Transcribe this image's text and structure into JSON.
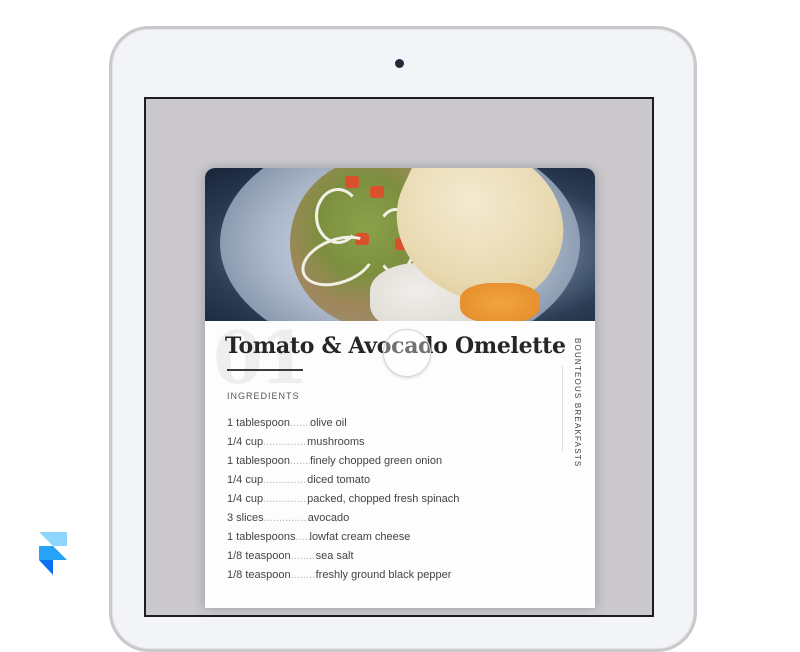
{
  "recipe": {
    "number": "01",
    "title": "Tomato & Avocado Omelette",
    "category": "BOUNTEOUS BREAKFASTS",
    "section_label": "INGREDIENTS",
    "ingredients": [
      {
        "qty": "1 tablespoon",
        "item": "olive oil"
      },
      {
        "qty": "1/4 cup",
        "item": "mushrooms"
      },
      {
        "qty": "1 tablespoon",
        "item": "finely chopped green onion"
      },
      {
        "qty": "1/4 cup",
        "item": "diced tomato"
      },
      {
        "qty": "1/4 cup",
        "item": "packed, chopped fresh spinach"
      },
      {
        "qty": "3 slices",
        "item": "avocado"
      },
      {
        "qty": "1 tablespoons",
        "item": "lowfat cream cheese"
      },
      {
        "qty": "1/8 teaspoon",
        "item": "sea salt"
      },
      {
        "qty": "1/8 teaspoon",
        "item": "freshly ground black pepper"
      }
    ],
    "leader": "................................"
  },
  "colors": {
    "screen_bg": "#cbc9cd",
    "device_bezel": "#f3f4f8",
    "logo_light": "#8fd6ff",
    "logo_mid": "#27a3f5",
    "logo_dark": "#0a6ff0"
  },
  "logo": {
    "icon": "framer-logo-icon"
  }
}
